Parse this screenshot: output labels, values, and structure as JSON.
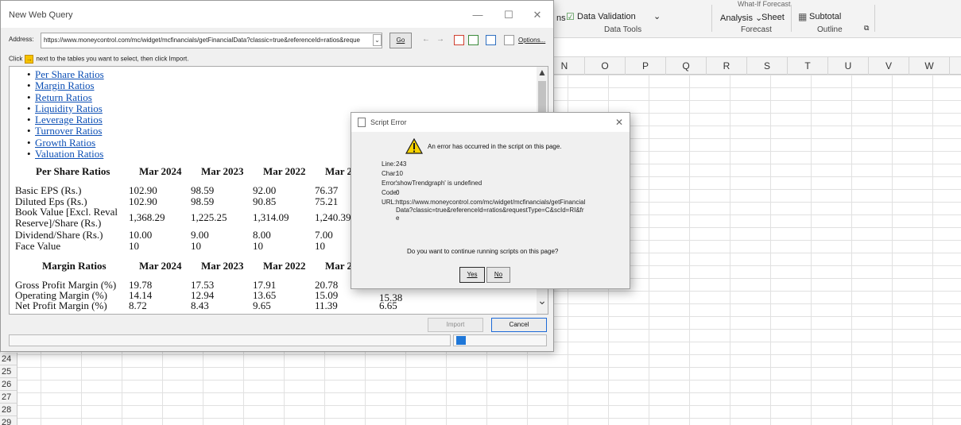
{
  "excel": {
    "ribbon": {
      "partial_left": "ns",
      "data_validation": "Data Validation",
      "data_validation_caret": "⌄",
      "data_tools_group": "Data Tools",
      "what_if_cut": "What-If  Forecast",
      "analysis": "Analysis ⌄",
      "sheet": "Sheet",
      "forecast_group": "Forecast",
      "subtotal": "Subtotal",
      "outline_group": "Outline",
      "launcher": "⧉"
    },
    "columns": [
      "N",
      "O",
      "P",
      "Q",
      "R",
      "S",
      "T",
      "U",
      "V",
      "W"
    ],
    "rows": [
      "24",
      "25",
      "26",
      "27",
      "28",
      "29"
    ]
  },
  "web_query": {
    "title": "New Web Query",
    "minimize": "—",
    "maximize": "☐",
    "close": "✕",
    "address_label": "Address:",
    "address_value": "https://www.moneycontrol.com/mc/widget/mcfinancials/getFinancialData?classic=true&referenceId=ratios&reque",
    "address_dropdown": "⌄",
    "go_label": "Go",
    "back": "←",
    "forward": "→",
    "options_label": "Options...",
    "instruction_click": "Click",
    "instruction_rest": "next to the tables you want to select, then click Import.",
    "arrow_glyph": "→",
    "links": [
      "Per Share Ratios",
      "Margin Ratios",
      "Return Ratios",
      "Liquidity Ratios",
      "Leverage Ratios",
      "Turnover Ratios",
      "Growth Ratios",
      "Valuation Ratios"
    ],
    "per_share": {
      "title": "Per Share Ratios",
      "headers": [
        "Mar 2024",
        "Mar 2023",
        "Mar 2022",
        "Mar 2"
      ],
      "rows": [
        {
          "label": "Basic EPS (Rs.)",
          "values": [
            "102.90",
            "98.59",
            "92.00",
            "76.37"
          ]
        },
        {
          "label": "Diluted Eps (Rs.)",
          "values": [
            "102.90",
            "98.59",
            "90.85",
            "75.21"
          ]
        },
        {
          "label": "Book Value [Excl. Reval",
          "label2": "Reserve]/Share (Rs.)",
          "values": [
            "1,368.29",
            "1,225.25",
            "1,314.09",
            "1,240.39"
          ]
        },
        {
          "label": "Dividend/Share (Rs.)",
          "values": [
            "10.00",
            "9.00",
            "8.00",
            "7.00"
          ]
        },
        {
          "label": "Face Value",
          "values": [
            "10",
            "10",
            "10",
            "10"
          ]
        }
      ]
    },
    "margin": {
      "title": "Margin Ratios",
      "headers": [
        "Mar 2024",
        "Mar 2023",
        "Mar 2022",
        "Mar 2"
      ],
      "rows": [
        {
          "label": "Gross Profit Margin (%)",
          "values": [
            "19.78",
            "17.53",
            "17.91",
            "20.78"
          ]
        },
        {
          "label": "Operating Margin (%)",
          "values": [
            "14.14",
            "12.94",
            "13.65",
            "15.09",
            "15.38"
          ]
        },
        {
          "label": "Net Profit Margin (%)",
          "values": [
            "8.72",
            "8.43",
            "9.65",
            "11.39",
            "6.65"
          ]
        }
      ]
    },
    "scroll_up": "▲",
    "scroll_down": "⌄",
    "import_label": "Import",
    "cancel_label": "Cancel"
  },
  "script_error": {
    "title": "Script Error",
    "close": "✕",
    "message": "An error has occurred in the script on this page.",
    "line_key": "Line:",
    "line_val": "243",
    "char_key": "Char:",
    "char_val": "10",
    "error_key": "Error:",
    "error_val": "'showTrendgraph' is undefined",
    "code_key": "Code:",
    "code_val": "0",
    "url_key": "URL:",
    "url_val": "https://www.moneycontrol.com/mc/widget/mcfinancials/getFinancialData?classic=true&referenceId=ratios&requestType=C&scId=RI&fre",
    "question": "Do you want to continue running scripts on this page?",
    "yes_label": "Yes",
    "no_label": "No"
  }
}
